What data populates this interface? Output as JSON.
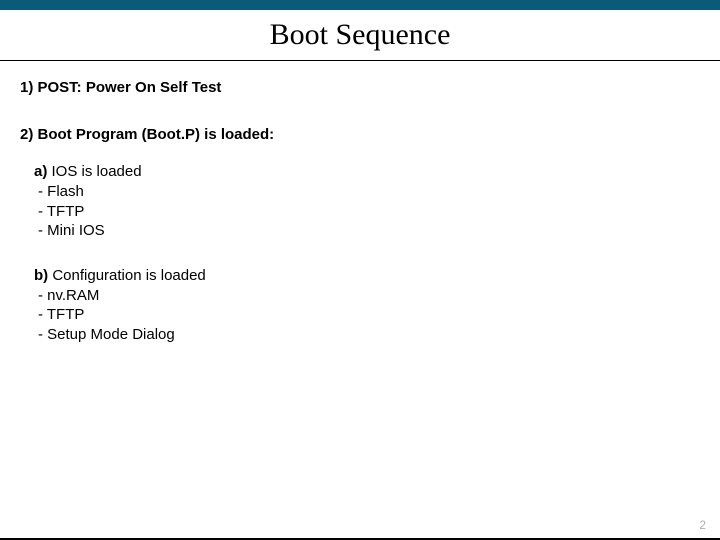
{
  "title": "Boot Sequence",
  "section1": "1) POST: Power On Self Test",
  "section2": "2) Boot Program (Boot.P) is loaded:",
  "subA": {
    "label": "a)",
    "text": " IOS is loaded",
    "items": [
      "- Flash",
      "- TFTP",
      "- Mini IOS"
    ]
  },
  "subB": {
    "label": "b)",
    "text": " Configuration is loaded",
    "items": [
      "- nv.RAM",
      "- TFTP",
      "- Setup Mode Dialog"
    ]
  },
  "pageNumber": "2"
}
